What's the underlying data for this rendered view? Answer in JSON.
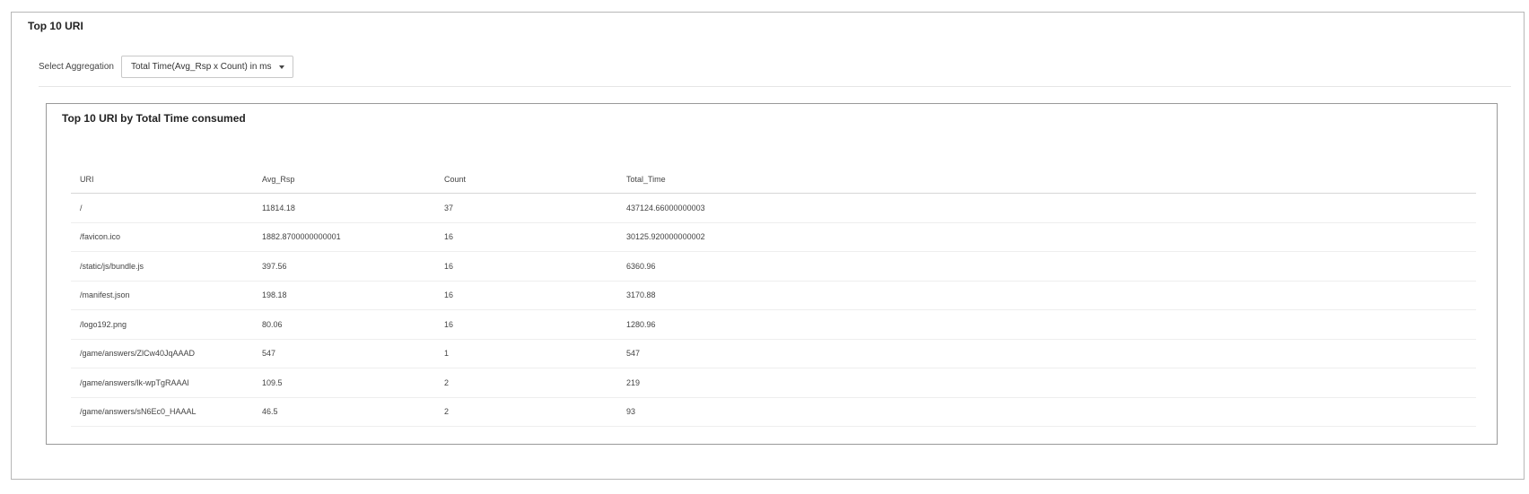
{
  "panel": {
    "title": "Top 10 URI"
  },
  "aggregation": {
    "label": "Select Aggregation",
    "selected": "Total Time(Avg_Rsp x Count) in ms"
  },
  "inner_panel": {
    "title": "Top 10 URI by Total Time consumed"
  },
  "table": {
    "columns": [
      "URI",
      "Avg_Rsp",
      "Count",
      "Total_Time"
    ],
    "rows": [
      [
        "/",
        "11814.18",
        "37",
        "437124.66000000003"
      ],
      [
        "/favicon.ico",
        "1882.8700000000001",
        "16",
        "30125.920000000002"
      ],
      [
        "/static/js/bundle.js",
        "397.56",
        "16",
        "6360.96"
      ],
      [
        "/manifest.json",
        "198.18",
        "16",
        "3170.88"
      ],
      [
        "/logo192.png",
        "80.06",
        "16",
        "1280.96"
      ],
      [
        "/game/answers/ZlCw40JqAAAD",
        "547",
        "1",
        "547"
      ],
      [
        "/game/answers/lk-wpTgRAAAl",
        "109.5",
        "2",
        "219"
      ],
      [
        "/game/answers/sN6Ec0_HAAAL",
        "46.5",
        "2",
        "93"
      ]
    ]
  }
}
